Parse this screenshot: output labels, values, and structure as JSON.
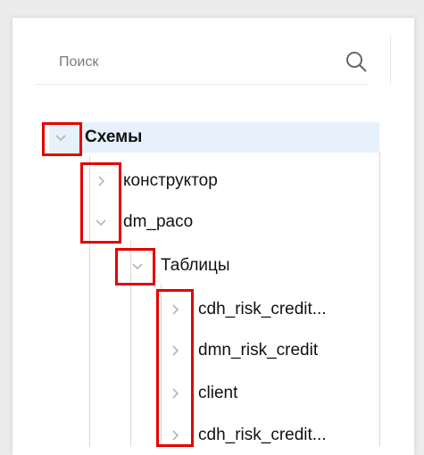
{
  "search": {
    "placeholder": "Поиск"
  },
  "tree": {
    "root": {
      "label": "Схемы"
    },
    "items": [
      {
        "label": "конструктор"
      },
      {
        "label": "dm_paco"
      },
      {
        "label": "Таблицы"
      },
      {
        "label": "cdh_risk_credit..."
      },
      {
        "label": "dmn_risk_credit"
      },
      {
        "label": "client"
      },
      {
        "label": "cdh_risk_credit..."
      }
    ]
  },
  "colors": {
    "highlight": "#e30000",
    "selected_row": "#e6f1fb"
  }
}
